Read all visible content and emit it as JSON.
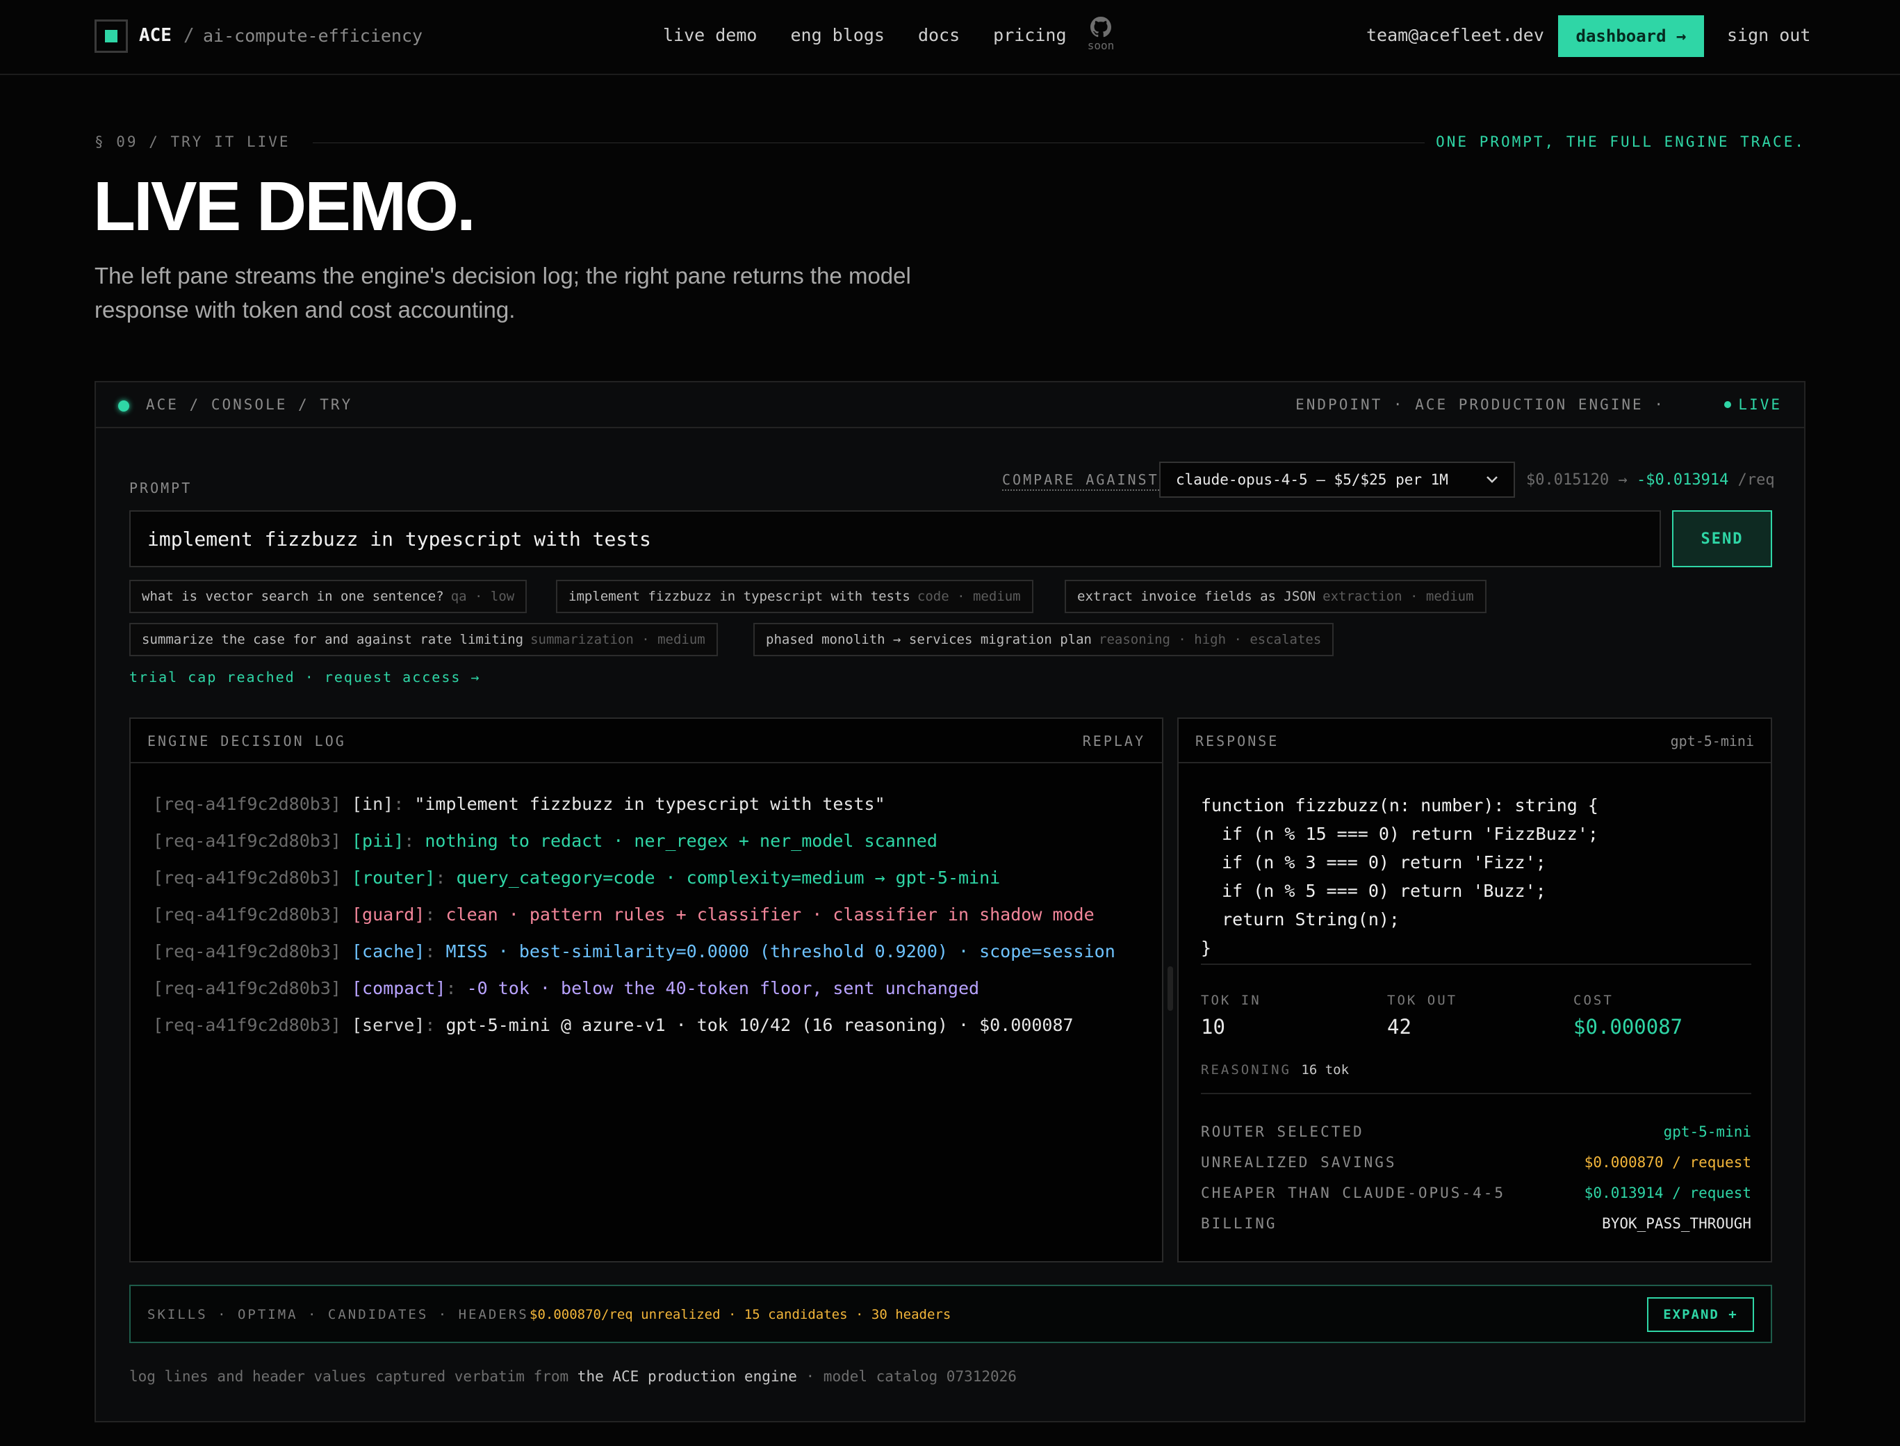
{
  "nav": {
    "brand": "ACE",
    "brand_sep": "/",
    "brand_sub": "ai-compute-efficiency",
    "links": [
      "live demo",
      "eng blogs",
      "docs",
      "pricing"
    ],
    "github_soon": "soon",
    "email": "team@acefleet.dev",
    "dashboard": "dashboard →",
    "signout": "sign out"
  },
  "hero": {
    "section_tag": "§ 09 / TRY IT LIVE",
    "section_right": "ONE PROMPT, THE FULL ENGINE TRACE.",
    "title": "LIVE DEMO.",
    "description": "The left pane streams the engine's decision log; the right pane returns the model response with token and cost accounting."
  },
  "console": {
    "crumb": "ACE / CONSOLE / TRY",
    "endpoint": "ENDPOINT · ACE PRODUCTION ENGINE ·",
    "live": "LIVE",
    "prompt_label": "PROMPT",
    "compare_label": "COMPARE AGAINST",
    "compare_model": "claude-opus-4-5 — $5/$25 per 1M",
    "price_from": "$0.015120 →",
    "price_delta": "-$0.013914",
    "price_unit": "/req",
    "prompt_value": "implement fizzbuzz in typescript with tests",
    "send": "SEND",
    "chips": [
      {
        "text": "what is vector search in one sentence?",
        "meta": "qa · low"
      },
      {
        "text": "implement fizzbuzz in typescript with tests",
        "meta": "code · medium"
      },
      {
        "text": "extract invoice fields as JSON",
        "meta": "extraction · medium"
      },
      {
        "text": "summarize the case for and against rate limiting",
        "meta": "summarization · medium"
      },
      {
        "text": "phased monolith → services migration plan",
        "meta": "reasoning · high · escalates"
      }
    ],
    "trial": "trial cap reached · request access →"
  },
  "log": {
    "title": "ENGINE DECISION LOG",
    "replay": "REPLAY",
    "lines": [
      {
        "rid": "[req-a41f9c2d80b3]",
        "tag": "[in]",
        "sep": ": ",
        "msg": "\"implement fizzbuzz in typescript with tests\"",
        "color": "white"
      },
      {
        "rid": "[req-a41f9c2d80b3]",
        "tag": "[pii]",
        "sep": ": ",
        "msg": "nothing to redact · ner_regex + ner_model scanned",
        "color": "green"
      },
      {
        "rid": "[req-a41f9c2d80b3]",
        "tag": "[router]",
        "sep": ": ",
        "msg": "query_category=code · complexity=medium → gpt-5-mini",
        "color": "green"
      },
      {
        "rid": "[req-a41f9c2d80b3]",
        "tag": "[guard]",
        "sep": ": ",
        "msg": "clean · pattern rules + classifier · classifier in shadow mode",
        "color": "red"
      },
      {
        "rid": "[req-a41f9c2d80b3]",
        "tag": "[cache]",
        "sep": ": ",
        "msg": "MISS · best-similarity=0.0000 (threshold 0.9200) · scope=session",
        "color": "blue"
      },
      {
        "rid": "[req-a41f9c2d80b3]",
        "tag": "[compact]",
        "sep": ": ",
        "msg": "-0 tok · below the 40-token floor, sent unchanged",
        "color": "violet"
      },
      {
        "rid": "[req-a41f9c2d80b3]",
        "tag": "[serve]",
        "sep": ": ",
        "msg": "gpt-5-mini @ azure-v1 · tok 10/42 (16 reasoning) · $0.000087",
        "color": "white"
      }
    ]
  },
  "response": {
    "title": "RESPONSE",
    "model": "gpt-5-mini",
    "code": [
      "function fizzbuzz(n: number): string {",
      "  if (n % 15 === 0) return 'FizzBuzz';",
      "  if (n % 3 === 0) return 'Fizz';",
      "  if (n % 5 === 0) return 'Buzz';",
      "  return String(n);",
      "}"
    ],
    "tok_in_label": "TOK IN",
    "tok_in": "10",
    "tok_out_label": "TOK OUT",
    "tok_out": "42",
    "cost_label": "COST",
    "cost": "$0.000087",
    "reasoning_label": "REASONING",
    "reasoning": "16 tok",
    "rows": [
      {
        "k": "ROUTER SELECTED",
        "v": "gpt-5-mini",
        "color": "green"
      },
      {
        "k": "UNREALIZED SAVINGS",
        "v": "$0.000870 / request",
        "color": "orange"
      },
      {
        "k": "CHEAPER THAN CLAUDE-OPUS-4-5",
        "v": "$0.013914 / request",
        "color": "green"
      },
      {
        "k": "BILLING",
        "v": "BYOK_PASS_THROUGH",
        "color": "white"
      }
    ]
  },
  "skills": {
    "label": "SKILLS · OPTIMA · CANDIDATES · HEADERS",
    "stats": "$0.000870/req unrealized · 15 candidates · 30 headers",
    "expand": "EXPAND +"
  },
  "footnote": {
    "pre": "log lines and header values captured verbatim from ",
    "emph": "the ACE production engine",
    "post": " · model catalog 07312026"
  },
  "colors": {
    "accent": "#2fd6a6",
    "warn": "#f3b63a",
    "red": "#f2869a",
    "blue": "#6ec3ff",
    "violet": "#b9a3ff"
  }
}
